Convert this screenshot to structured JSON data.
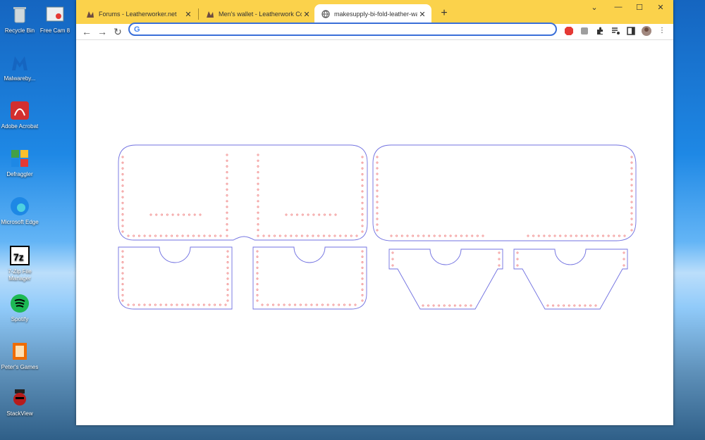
{
  "desktop": {
    "icons": [
      {
        "name": "recycle-bin",
        "label": "Recycle Bin",
        "color": "#cfd8dc"
      },
      {
        "name": "free-cam-8",
        "label": "Free Cam 8",
        "color": "#e0e0e0"
      },
      {
        "name": "malwarebytes",
        "label": "Malwareby...",
        "color": "#1565c0"
      },
      {
        "name": "adobe-acrobat",
        "label": "Adobe Acrobat",
        "color": "#d32f2f"
      },
      {
        "name": "defraggler",
        "label": "Defraggler",
        "color": "#4caf50"
      },
      {
        "name": "microsoft-edge",
        "label": "Microsoft Edge",
        "color": "#1e88e5"
      },
      {
        "name": "7zip",
        "label": "7-Zip File Manager",
        "color": "#111111"
      },
      {
        "name": "spotify",
        "label": "Spotify",
        "color": "#1db954"
      },
      {
        "name": "peters-games",
        "label": "Peter's Games",
        "color": "#ef6c00"
      },
      {
        "name": "stackview",
        "label": "StackView",
        "color": "#b71c1c"
      }
    ]
  },
  "browser": {
    "tabs": [
      {
        "title": "Forums - Leatherworker.net",
        "active": false
      },
      {
        "title": "Men's wallet - Leatherwork Comm",
        "active": false
      },
      {
        "title": "makesupply-bi-fold-leather-wallet",
        "active": true
      }
    ],
    "new_tab_symbol": "+",
    "window_controls": {
      "minimize": "—",
      "maximize": "☐",
      "close": "✕",
      "chevron": "⌄"
    },
    "address": {
      "value": "",
      "placeholder": ""
    },
    "accent_color": "#fbd24b"
  },
  "pattern": {
    "outline_color": "#7070e0",
    "stitch_color": "#f08080"
  }
}
